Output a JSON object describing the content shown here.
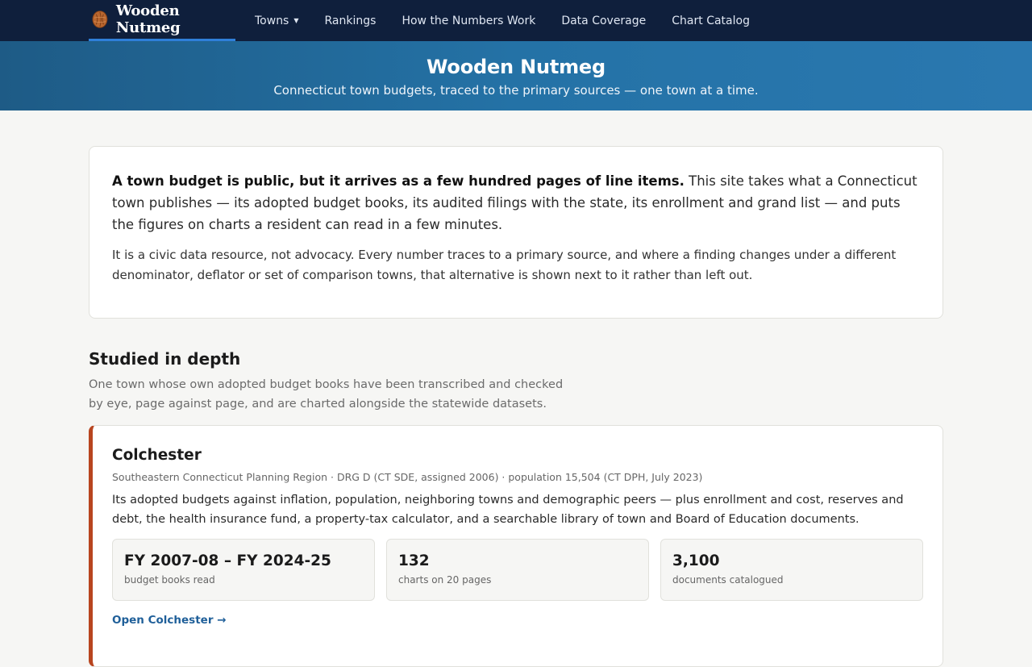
{
  "nav": {
    "brand": "Wooden Nutmeg",
    "brand_icon": "nutmeg-icon",
    "items": [
      {
        "label": "Towns",
        "has_dropdown": true
      },
      {
        "label": "Rankings"
      },
      {
        "label": "How the Numbers Work"
      },
      {
        "label": "Data Coverage"
      },
      {
        "label": "Chart Catalog"
      }
    ]
  },
  "hero": {
    "title": "Wooden Nutmeg",
    "subtitle": "Connecticut town budgets, traced to the primary sources — one town at a time."
  },
  "intro": {
    "lead_bold": "A town budget is public, but it arrives as a few hundred pages of line items.",
    "lead_rest": " This site takes what a Connecticut town publishes — its adopted budget books, its audited filings with the state, its enrollment and grand list — and puts the figures on charts a resident can read in a few minutes.",
    "paragraph2": "It is a civic data resource, not advocacy. Every number traces to a primary source, and where a finding changes under a different denominator, deflator or set of comparison towns, that alternative is shown next to it rather than left out."
  },
  "section": {
    "title": "Studied in depth",
    "subtitle": "One town whose own adopted budget books have been transcribed and checked by eye, page against page, and are charted alongside the statewide datasets."
  },
  "town": {
    "name": "Colchester",
    "meta": "Southeastern Connecticut Planning Region · DRG D (CT SDE, assigned 2006) · population 15,504 (CT DPH, July 2023)",
    "description": "Its adopted budgets against inflation, population, neighboring towns and demographic peers — plus enrollment and cost, reserves and debt, the health insurance fund, a property-tax calculator, and a searchable library of town and Board of Education documents.",
    "stats": [
      {
        "value": "FY 2007-08 – FY 2024-25",
        "label": "budget books read"
      },
      {
        "value": "132",
        "label": "charts on 20 pages"
      },
      {
        "value": "3,100",
        "label": "documents catalogued"
      }
    ],
    "link_label": "Open Colchester →"
  },
  "colors": {
    "nav_bg": "#0f1f3c",
    "accent_underline": "#2f7fd9",
    "hero_start": "#1e5b86",
    "hero_end": "#2a78b0",
    "card_accent": "#b8451f",
    "link": "#1f5f99"
  }
}
